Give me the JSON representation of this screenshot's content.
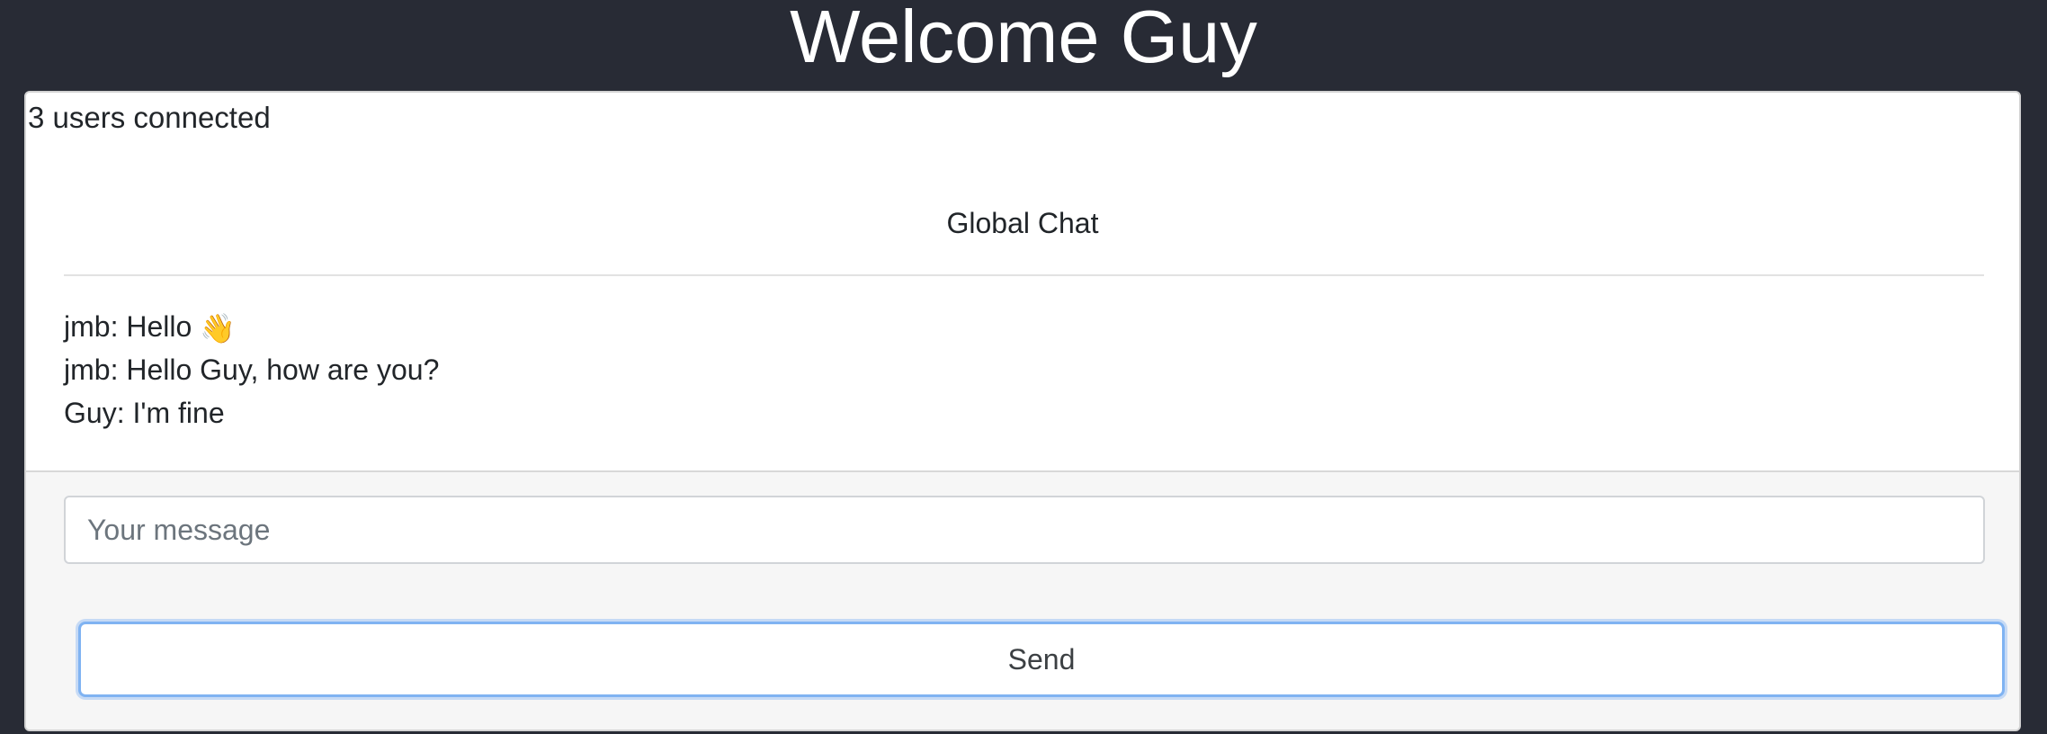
{
  "header": {
    "title": "Welcome Guy"
  },
  "status": {
    "users_connected": "3 users connected"
  },
  "chat": {
    "title": "Global Chat",
    "messages": [
      {
        "author": "jmb",
        "text": "Hello",
        "emoji": "👋",
        "emoji_icon": "waving-hand-icon"
      },
      {
        "author": "jmb",
        "text": "Hello Guy, how are you?"
      },
      {
        "author": "Guy",
        "text": "I'm fine"
      }
    ]
  },
  "composer": {
    "input_value": "",
    "input_placeholder": "Your message",
    "send_label": "Send"
  },
  "colors": {
    "page_background": "#282b35",
    "card_background": "#ffffff",
    "footer_background": "#f6f6f6",
    "send_focus_ring": "#80b3f2"
  }
}
